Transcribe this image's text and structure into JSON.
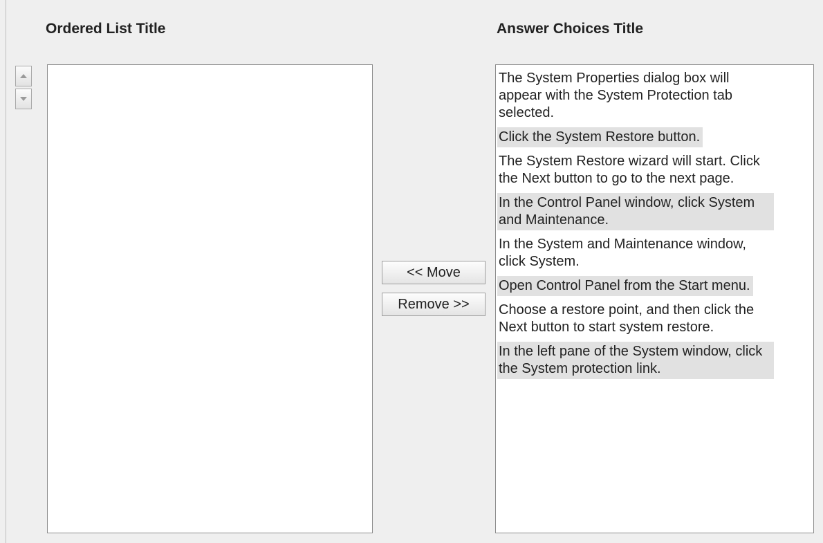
{
  "ordered_list": {
    "title": "Ordered List Title",
    "items": []
  },
  "answer_choices": {
    "title": "Answer Choices Title",
    "items": [
      "The System Properties dialog box will appear with the System Protection tab selected.",
      "Click the System Restore button.",
      "The System Restore wizard will start. Click the Next button to go to the next page.",
      "In the Control Panel window, click System and Maintenance.",
      "In the System and Maintenance window, click System.",
      "Open Control Panel from the Start menu.",
      "Choose a restore point, and then click the Next button to start system restore.",
      "In the left pane of the System window, click the System protection link."
    ]
  },
  "buttons": {
    "move_label": "<< Move",
    "remove_label": "Remove >>"
  },
  "icons": {
    "up": "arrow-up-icon",
    "down": "arrow-down-icon"
  },
  "colors": {
    "background": "#efefef",
    "list_background": "#ffffff",
    "alternate_row": "#e1e1e1"
  }
}
